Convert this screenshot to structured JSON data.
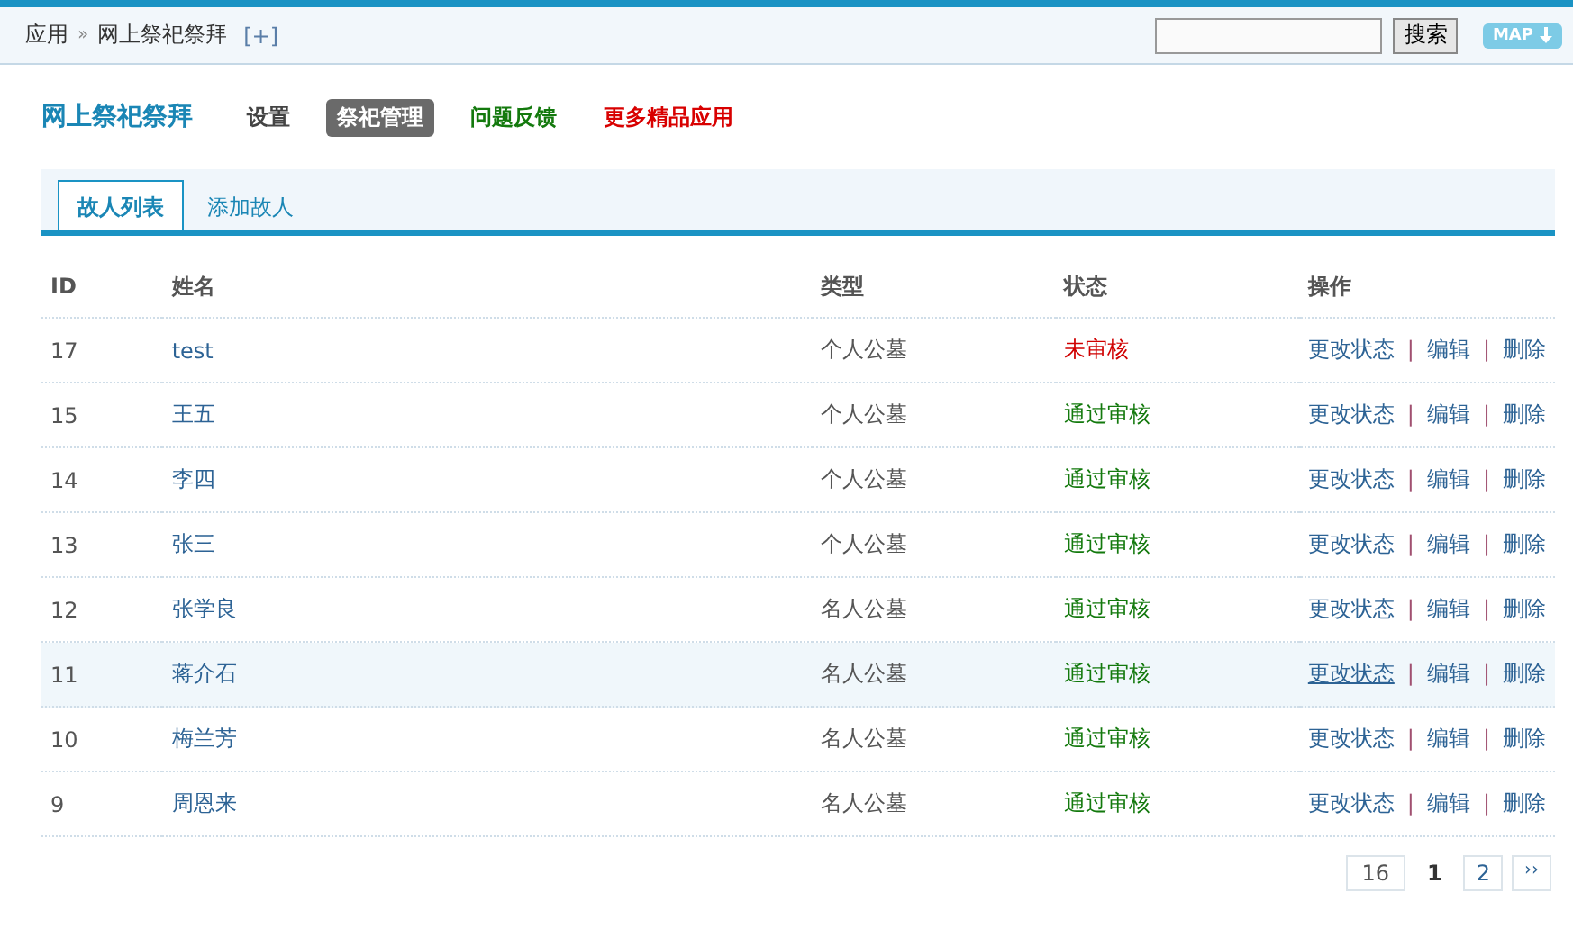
{
  "breadcrumb": {
    "items": [
      "应用",
      "网上祭祀祭拜"
    ],
    "separator": "»",
    "add": "[+]"
  },
  "search": {
    "button": "搜索"
  },
  "map_button": "MAP",
  "app_title": "网上祭祀祭拜",
  "nav": [
    {
      "label": "设置",
      "kind": "plain",
      "selected": false
    },
    {
      "label": "祭祀管理",
      "kind": "plain",
      "selected": true
    },
    {
      "label": "问题反馈",
      "kind": "green",
      "selected": false
    },
    {
      "label": "更多精品应用",
      "kind": "red",
      "selected": false
    }
  ],
  "tabs": [
    {
      "label": "故人列表",
      "selected": true
    },
    {
      "label": "添加故人",
      "selected": false
    }
  ],
  "table": {
    "columns": [
      "ID",
      "姓名",
      "类型",
      "状态",
      "操作"
    ],
    "rows": [
      {
        "id": "17",
        "name": "test",
        "type": "个人公墓",
        "status": "未审核",
        "color": "#d00000",
        "highlighted": false,
        "actions": [
          "更改状态",
          "编辑",
          "删除"
        ]
      },
      {
        "id": "15",
        "name": "王五",
        "type": "个人公墓",
        "status": "通过审核",
        "color": "#13790d",
        "highlighted": false,
        "actions": [
          "更改状态",
          "编辑",
          "删除"
        ]
      },
      {
        "id": "14",
        "name": "李四",
        "type": "个人公墓",
        "status": "通过审核",
        "color": "#13790d",
        "highlighted": false,
        "actions": [
          "更改状态",
          "编辑",
          "删除"
        ]
      },
      {
        "id": "13",
        "name": "张三",
        "type": "个人公墓",
        "status": "通过审核",
        "color": "#13790d",
        "highlighted": false,
        "actions": [
          "更改状态",
          "编辑",
          "删除"
        ]
      },
      {
        "id": "12",
        "name": "张学良",
        "type": "名人公墓",
        "status": "通过审核",
        "color": "#13790d",
        "highlighted": false,
        "actions": [
          "更改状态",
          "编辑",
          "删除"
        ]
      },
      {
        "id": "11",
        "name": "蒋介石",
        "type": "名人公墓",
        "status": "通过审核",
        "color": "#13790d",
        "highlighted": true,
        "actions": [
          "更改状态",
          "编辑",
          "删除"
        ]
      },
      {
        "id": "10",
        "name": "梅兰芳",
        "type": "名人公墓",
        "status": "通过审核",
        "color": "#13790d",
        "highlighted": false,
        "actions": [
          "更改状态",
          "编辑",
          "删除"
        ]
      },
      {
        "id": "9",
        "name": "周恩来",
        "type": "名人公墓",
        "status": "通过审核",
        "color": "#13790d",
        "highlighted": false,
        "actions": [
          "更改状态",
          "编辑",
          "删除"
        ]
      }
    ],
    "action_separator": "|"
  },
  "pagination": {
    "total": "16",
    "pages": [
      {
        "label": "1",
        "selected": true
      },
      {
        "label": "2",
        "selected": false
      }
    ],
    "next": "››"
  }
}
